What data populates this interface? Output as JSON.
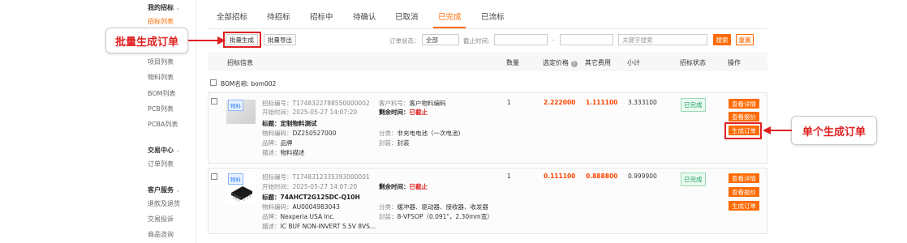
{
  "sidebar": {
    "sections": [
      {
        "title": "我的招标",
        "items": [
          "招标列表"
        ]
      },
      {
        "title": "",
        "items": [
          "项目列表",
          "物料列表",
          "BOM列表",
          "PCB列表",
          "PCBA列表"
        ]
      },
      {
        "title": "交易中心",
        "items": [
          "订单列表"
        ]
      },
      {
        "title": "客户服务",
        "items": [
          "退款及退货",
          "交易投诉",
          "商品咨询"
        ]
      }
    ],
    "arrow": "⌄"
  },
  "tabs": [
    "全部招标",
    "待招标",
    "招标中",
    "待确认",
    "已取消",
    "已完成",
    "已流标"
  ],
  "active_tab": "已完成",
  "toolbar": {
    "batch_generate": "批量生成",
    "batch_export": "批量导出",
    "order_status_label": "订单状态：",
    "order_status_value": "全部",
    "deadline_label": "截止时间:",
    "range_sep": "-",
    "keyword_placeholder": "关键字搜索",
    "search": "搜索",
    "reset": "重置"
  },
  "table_headers": {
    "info": "招标信息",
    "qty": "数量",
    "price": "选定价格",
    "other_fee": "其它费用",
    "subtotal": "小计",
    "status": "招标状态",
    "ops": "操作"
  },
  "bom": {
    "label": "BOM名称:",
    "value": "bom002"
  },
  "orders": [
    {
      "tag": "物料",
      "bid_no": "招标编号：T1748322788550000002",
      "start_time": "开始时间：2025-05-27 14:07:20",
      "title_label": "标题：",
      "title": "定制物料测试",
      "material_no": "物料编码：",
      "material_no_val": "DZ250527000",
      "brand": "品牌：",
      "brand_val": "品牌",
      "desc": "描述：",
      "desc_val": "物料描述",
      "customer_part": "客户料号：",
      "customer_part_val": "客户物料编码",
      "remaining_label": "剩余时间：",
      "remaining_val": "已截止",
      "category": "分类：",
      "category_val": "非充电电池（一次电池)",
      "package": "封装：",
      "package_val": "封装",
      "qty": "1",
      "price": "2.222000",
      "other_fee": "1.111100",
      "subtotal": "3.333100",
      "status": "已完成",
      "ops": [
        "查看详情",
        "查看报价",
        "生成订单"
      ]
    },
    {
      "tag": "物料",
      "bid_no": "招标编号：T1748312335393000001",
      "start_time": "开始时间：2025-05-27 14:07:20",
      "title_label": "标题：",
      "title": "74AHCT2G125DC-Q10H",
      "material_no": "物料编码：",
      "material_no_val": "AU0004983043",
      "brand": "品牌：",
      "brand_val": "Nexperia USA Inc.",
      "desc": "描述：",
      "desc_val": "IC BUF NON-INVERT 5.5V 8VS...",
      "customer_part": "",
      "customer_part_val": "",
      "remaining_label": "剩余时间：",
      "remaining_val": "已截止",
      "category": "分类：",
      "category_val": "缓冲器、驱动器、接收器、收发器",
      "package": "封装：",
      "package_val": "8-VFSOP（0.091\"，2.30mm宽）",
      "qty": "1",
      "price": "0.111100",
      "other_fee": "0.888800",
      "subtotal": "0.999900",
      "status": "已完成",
      "ops": [
        "查看详情",
        "查看报价",
        "生成订单"
      ]
    }
  ],
  "annotations": {
    "left": "批量生成订单",
    "right": "单个生成订单"
  },
  "colors": {
    "accent": "#ff6a00",
    "annotation": "#e02020",
    "success": "#19a15f"
  }
}
